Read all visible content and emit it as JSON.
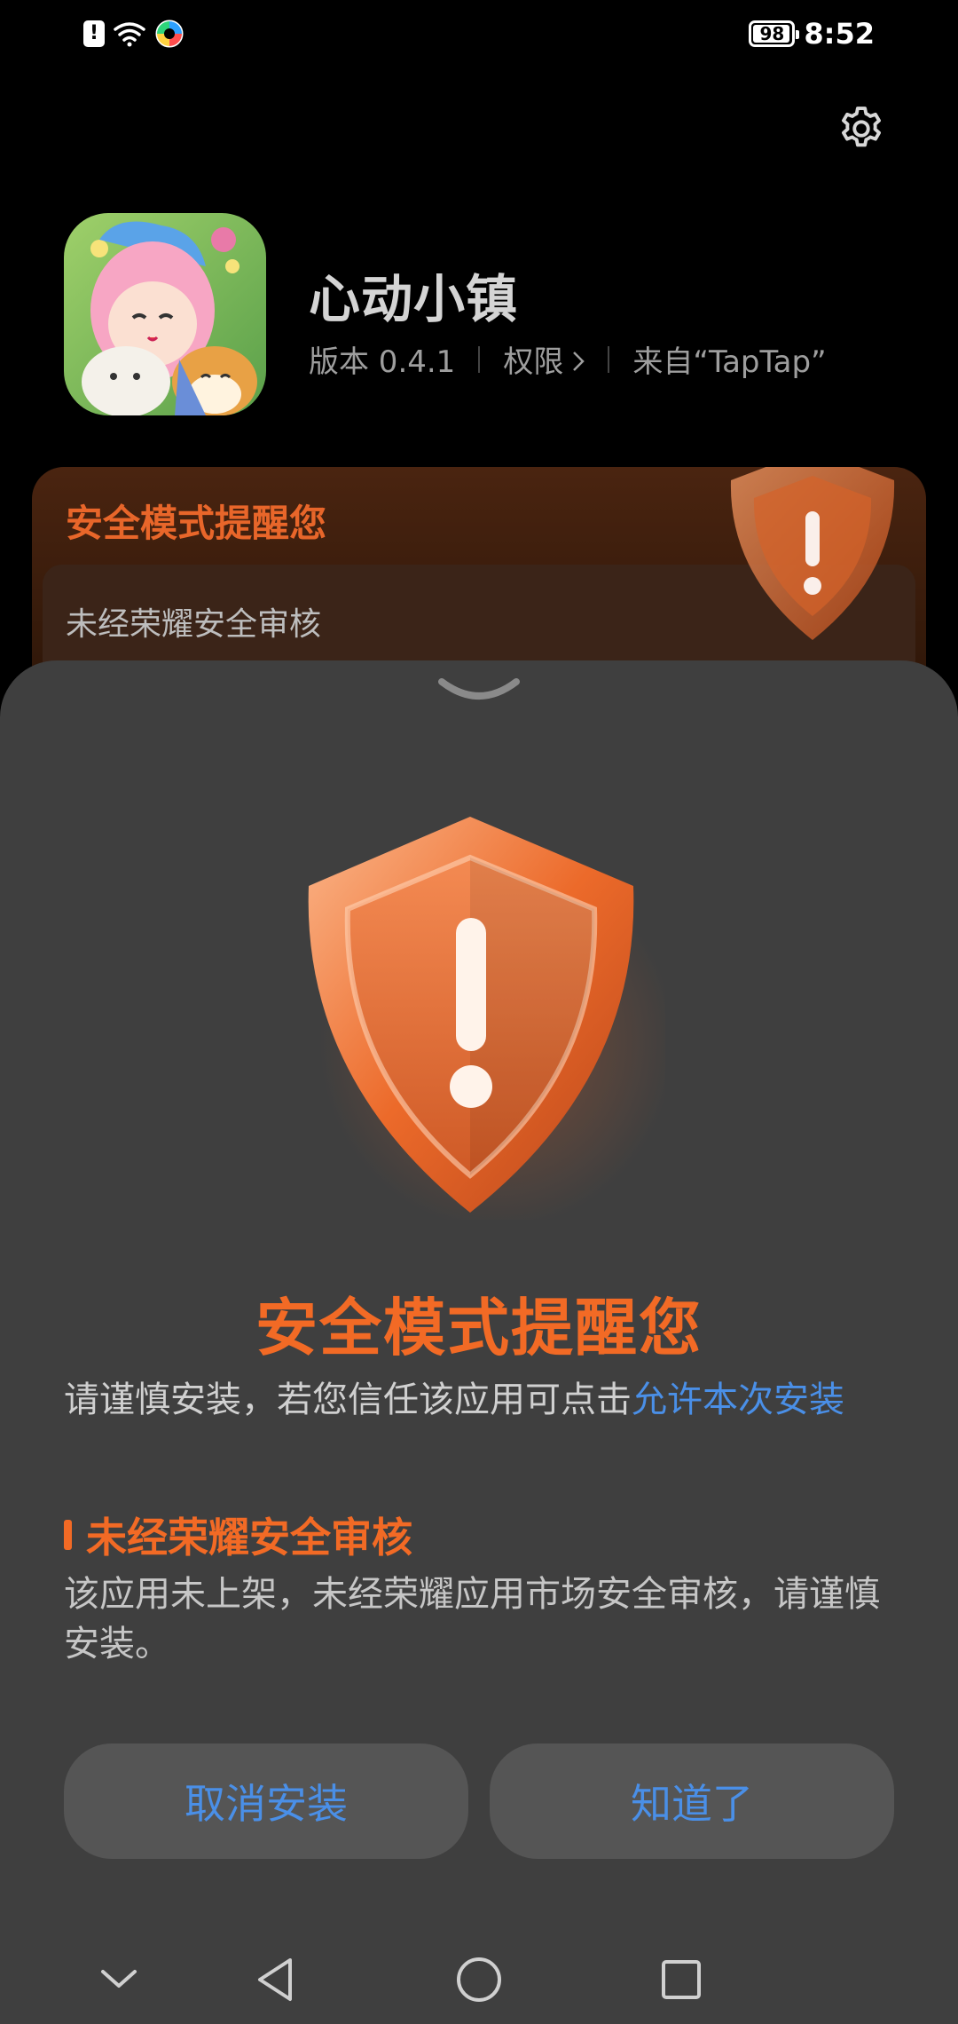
{
  "status_bar": {
    "battery": "98",
    "battery_level": 0.98,
    "time": "8:52"
  },
  "app": {
    "name": "心动小镇",
    "version": "版本 0.4.1",
    "permissions": "权限",
    "source": "来自“TapTap”"
  },
  "background_card": {
    "title": "安全模式提醒您",
    "subtitle": "未经荣耀安全审核"
  },
  "sheet": {
    "title": "安全模式提醒您",
    "description": "请谨慎安装，若您信任该应用可点击",
    "allow_link": "允许本次安装",
    "section_title": "未经荣耀安全审核",
    "section_body": "该应用未上架，未经荣耀应用市场安全审核，请谨慎安装。",
    "cancel_label": "取消安装",
    "ok_label": "知道了"
  },
  "icons": {
    "settings": "gear-icon",
    "collapse": "chevron-down-icon",
    "warning": "shield-warning-icon"
  },
  "colors": {
    "accent": "#f26a25",
    "link": "#4a8fe7",
    "sheet_bg": "#3f3f3f"
  }
}
